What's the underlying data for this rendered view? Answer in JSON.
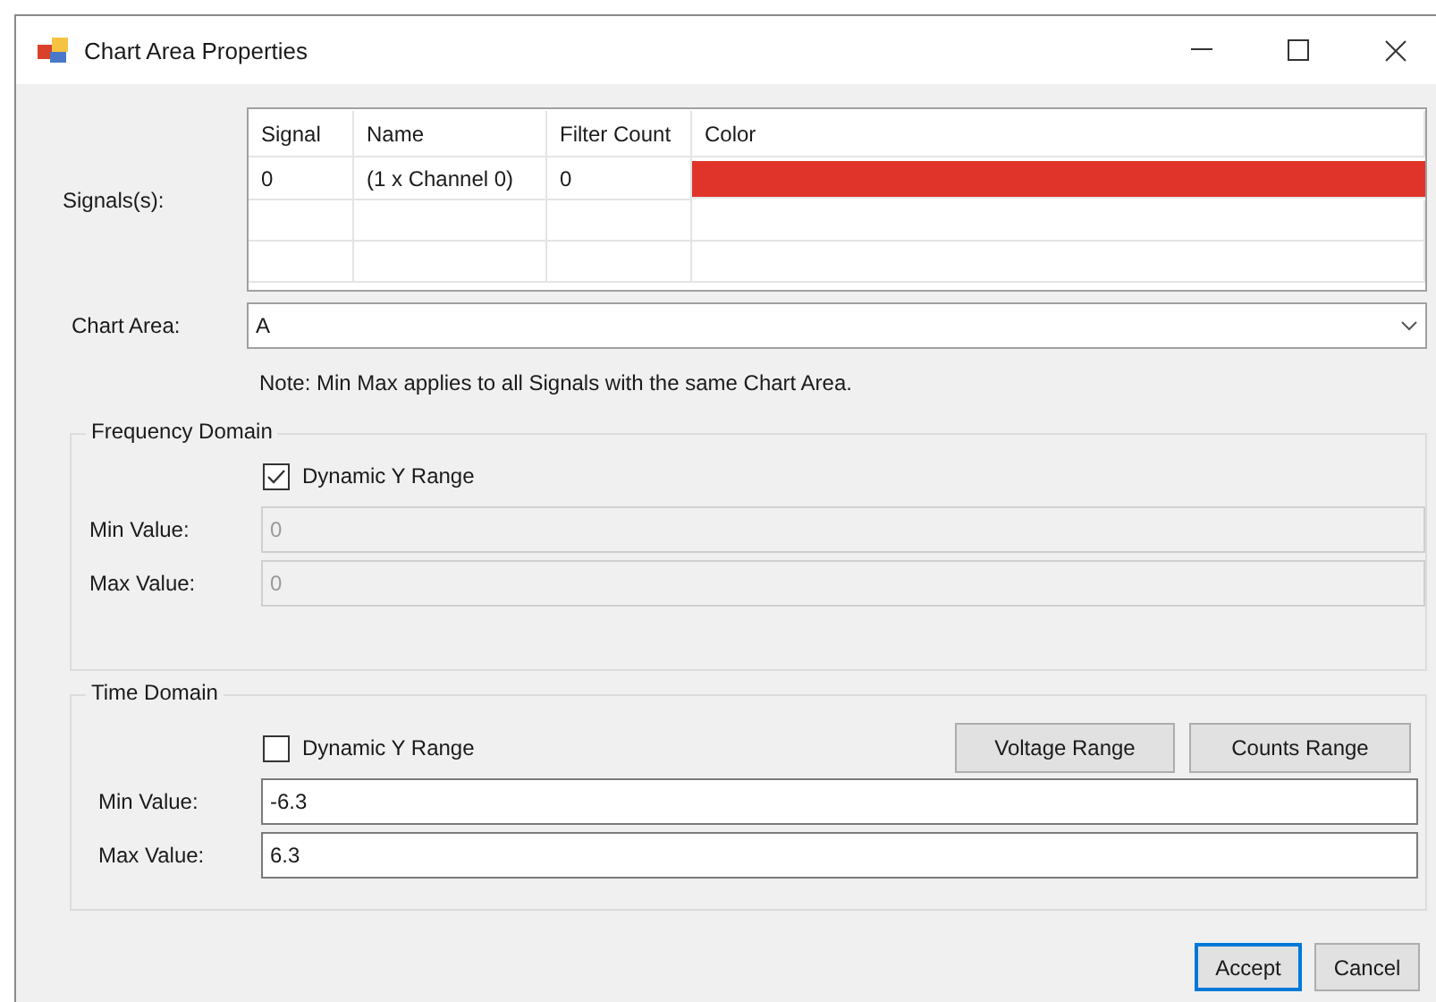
{
  "window": {
    "title": "Chart Area Properties"
  },
  "signals": {
    "label": "Signals(s):",
    "columns": [
      "Signal",
      "Name",
      "Filter Count",
      "Color"
    ],
    "rows": [
      {
        "signal": "0",
        "name": "(1 x Channel 0)",
        "filter_count": "0",
        "color": "#e0342a"
      }
    ]
  },
  "chart_area": {
    "label": "Chart Area:",
    "value": "A"
  },
  "note": "Note: Min Max applies to all Signals with the same Chart Area.",
  "groups": [
    {
      "title": "Frequency Domain",
      "dynamic_y_range": {
        "label": "Dynamic Y Range",
        "checked": true
      },
      "disabled": true,
      "fields": [
        {
          "label": "Min Value:",
          "value": "0"
        },
        {
          "label": "Max Value:",
          "value": "0"
        }
      ]
    },
    {
      "title": "Time Domain",
      "dynamic_y_range": {
        "label": "Dynamic Y Range",
        "checked": false
      },
      "disabled": false,
      "buttons": [
        "Voltage Range",
        "Counts Range"
      ],
      "fields": [
        {
          "label": "Min Value:",
          "value": "-6.3"
        },
        {
          "label": "Max Value:",
          "value": "6.3"
        }
      ]
    }
  ],
  "buttons": [
    {
      "label": "Accept",
      "default": true
    },
    {
      "label": "Cancel",
      "default": false
    }
  ]
}
